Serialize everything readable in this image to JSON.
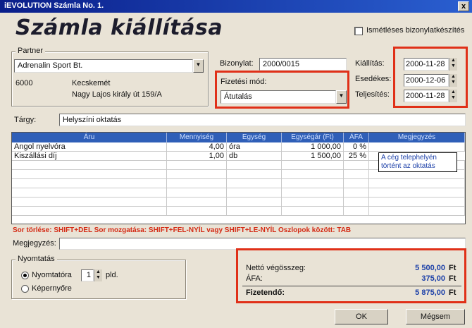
{
  "window": {
    "title": "iEVOLUTION Számla No. 1.",
    "close_label": "x"
  },
  "page_title": "Számla kiállítása",
  "repeat_checkbox": {
    "label": "Ismétléses bizonylatkészítés",
    "checked": false
  },
  "partner": {
    "legend": "Partner",
    "selected": "Adrenalin Sport Bt.",
    "zip": "6000",
    "city": "Kecskemét",
    "street": "Nagy Lajos király út 159/A"
  },
  "document": {
    "label": "Bizonylat:",
    "value": "2000/0015"
  },
  "payment": {
    "label": "Fizetési mód:",
    "selected": "Átutalás"
  },
  "dates": {
    "issue_label": "Kiállítás:",
    "issue_value": "2000-11-28",
    "due_label": "Esedékes:",
    "due_value": "2000-12-06",
    "fulfil_label": "Teljesítés:",
    "fulfil_value": "2000-11-28"
  },
  "subject": {
    "label": "Tárgy:",
    "value": "Helyszíni oktatás"
  },
  "grid": {
    "headers": [
      "Áru",
      "Mennyiség",
      "Egység",
      "Egységár (Ft)",
      "ÁFA",
      "Megjegyzés"
    ],
    "rows": [
      {
        "item": "Angol nyelvóra",
        "qty": "4,00",
        "unit": "óra",
        "price": "1 000,00",
        "vat": "0 %",
        "note": ""
      },
      {
        "item": "Kiszállási díj",
        "qty": "1,00",
        "unit": "db",
        "price": "1 500,00",
        "vat": "25 %",
        "note": "A cég telephelyén történt az oktatás"
      }
    ]
  },
  "hint": "Sor törlése: SHIFT+DEL    Sor mozgatása: SHIFT+FEL-NYÍL vagy SHIFT+LE-NYÍL    Oszlopok között: TAB",
  "remark": {
    "label": "Megjegyzés:",
    "value": ""
  },
  "printing": {
    "legend": "Nyomtatás",
    "printer_label": "Nyomtatóra",
    "screen_label": "Képernyőre",
    "copies": "1",
    "copies_unit": "pld.",
    "selected": "printer"
  },
  "totals": {
    "net_label": "Nettó végösszeg:",
    "net_value": "5 500,00",
    "net_cur": "Ft",
    "vat_label": "ÁFA:",
    "vat_value": "375,00",
    "vat_cur": "Ft",
    "pay_label": "Fizetendő:",
    "pay_value": "5 875,00",
    "pay_cur": "Ft"
  },
  "buttons": {
    "ok": "OK",
    "cancel": "Mégsem"
  },
  "colors": {
    "highlight": "#e03018",
    "grid_header": "#2f5fb8",
    "total_value": "#1b3fa8",
    "hint": "#d42a14"
  }
}
